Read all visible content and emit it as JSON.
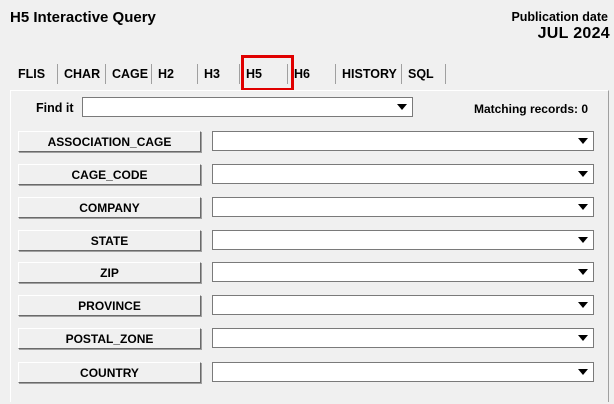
{
  "header": {
    "title": "H5 Interactive Query",
    "publication_label": "Publication date",
    "publication_value": "JUL 2024"
  },
  "tabs": [
    {
      "label": "FLIS"
    },
    {
      "label": "CHAR"
    },
    {
      "label": "CAGE"
    },
    {
      "label": "H2"
    },
    {
      "label": "H3"
    },
    {
      "label": "H5"
    },
    {
      "label": "H6"
    },
    {
      "label": "HISTORY"
    },
    {
      "label": "SQL"
    }
  ],
  "active_tab": "H5",
  "highlight_color": "#e00000",
  "find": {
    "label": "Find it",
    "value": "",
    "matching_label": "Matching records: 0"
  },
  "fields": [
    {
      "label": "ASSOCIATION_CAGE",
      "value": ""
    },
    {
      "label": "CAGE_CODE",
      "value": ""
    },
    {
      "label": "COMPANY",
      "value": ""
    },
    {
      "label": "STATE",
      "value": ""
    },
    {
      "label": "ZIP",
      "value": ""
    },
    {
      "label": "PROVINCE",
      "value": ""
    },
    {
      "label": "POSTAL_ZONE",
      "value": ""
    },
    {
      "label": "COUNTRY",
      "value": ""
    }
  ],
  "icons": {
    "dropdown": "chevron-down-icon"
  }
}
